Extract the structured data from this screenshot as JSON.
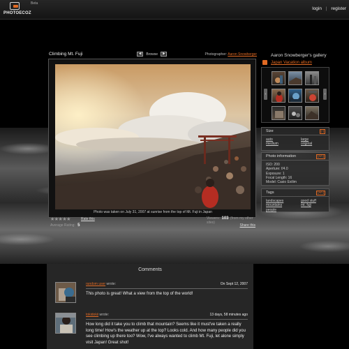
{
  "header": {
    "logo_text": "PHOTOECOZ",
    "beta": "Beta",
    "login": "login",
    "separator": "|",
    "register": "register"
  },
  "photo": {
    "title": "Climbing Mt. Fuji",
    "browse_label": "Browse",
    "prev_arrow": "◀",
    "next_arrow": "▶",
    "photographer_label": "Photographer:",
    "photographer_name": "Aaron Snowberger",
    "caption": "Photo was taken on July 31, 2007 at sunrise from the top of Mt. Fuji in Japan"
  },
  "stats": {
    "stars": "★★★★★",
    "rate_label": "Rate this",
    "average_label": "Average Rating:",
    "average_value": "5",
    "viewers_label": "Viewers:",
    "viewers_count": "103",
    "viewers_note": "(from my other sites)",
    "share_label": "Share this"
  },
  "gallery": {
    "title": "Aaron Snowberger's gallery",
    "album": "Japan Vacation album"
  },
  "size_panel": {
    "title": "Size",
    "toggle": "[-]",
    "options": [
      "auto",
      "medium",
      "large",
      "original"
    ]
  },
  "info_panel": {
    "title": "Photo information",
    "toggle": "[+/-]",
    "lines": [
      "ISO: 200",
      "Aperture: f/4.0",
      "Exposure: 1",
      "Focal Length: 16",
      "Model: Casio Exilim"
    ]
  },
  "tags_panel": {
    "title": "Tags",
    "toggle": "[+/-]",
    "tags": [
      "landscapes",
      "good stuff",
      "mountains",
      "mt. fuji",
      "people"
    ]
  },
  "comments": {
    "title": "Comments",
    "items": [
      {
        "author": "random user",
        "wrote": "wrote:",
        "date": "On Sept 12, 2007",
        "text": "This photo is great! What a view from the top of the world!"
      },
      {
        "author": "tokidokii",
        "wrote": "wrote:",
        "date": "13 days, 58 minutes ago",
        "text": "How long did it take you to climb that mountain? Seems like it must've taken a really long time!  How's the weather up at the top? Looks cold. And how many people did you see climbing up there too?  Wow, I've always wanted to climb Mt. Fuji, let alone simply visit Japan!  Great shot!"
      }
    ]
  }
}
